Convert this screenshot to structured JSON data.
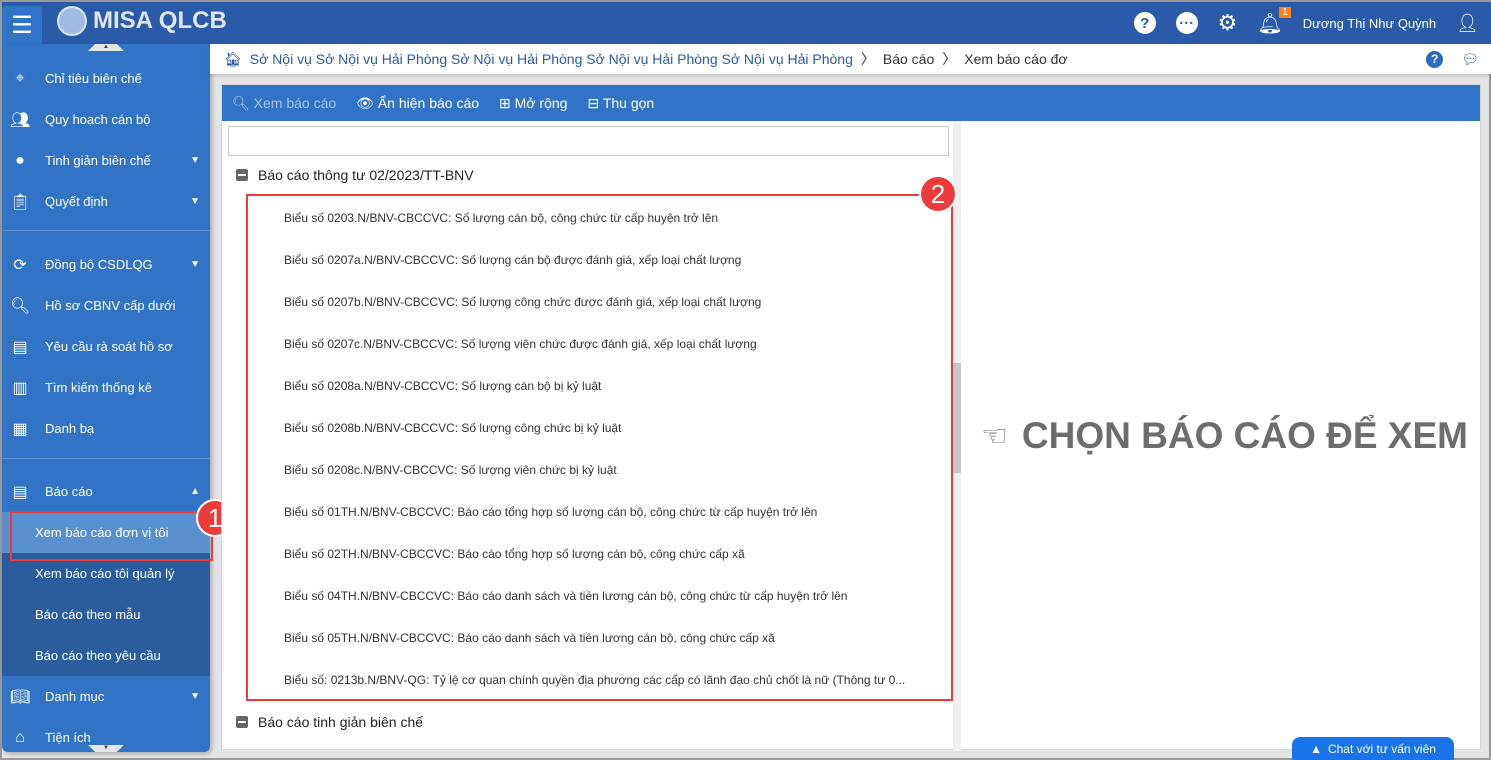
{
  "app": {
    "title": "MISA QLCB"
  },
  "header": {
    "notif_count": "1",
    "user_name": "Dương Thị Như Quỳnh"
  },
  "sidebar": {
    "items": [
      {
        "label": "Chỉ tiêu biên chế",
        "icon": "target-user-icon"
      },
      {
        "label": "Quy hoạch cán bộ",
        "icon": "people-icon"
      },
      {
        "label": "Tinh giản biên chế",
        "icon": "dots-icon",
        "caret": true
      },
      {
        "label": "Quyết định",
        "icon": "clipboard-icon",
        "caret": true
      },
      {
        "label": "Đồng bộ CSDLQG",
        "icon": "sync-icon",
        "caret": true
      },
      {
        "label": "Hồ sơ CBNV cấp dưới",
        "icon": "search-icon"
      },
      {
        "label": "Yêu cầu rà soát hồ sơ",
        "icon": "form-icon"
      },
      {
        "label": "Tìm kiếm thống kê",
        "icon": "chart-icon"
      },
      {
        "label": "Danh bạ",
        "icon": "contacts-icon"
      },
      {
        "label": "Báo cáo",
        "icon": "document-icon",
        "caret": true
      },
      {
        "label": "Danh mục",
        "icon": "book-icon",
        "caret": true
      },
      {
        "label": "Tiện ích",
        "icon": "home-icon"
      }
    ],
    "report_sub": [
      "Xem báo cáo đơn vị tôi",
      "Xem báo cáo tôi quản lý",
      "Báo cáo theo mẫu",
      "Báo cáo theo yêu cầu"
    ]
  },
  "breadcrumb": [
    "Sở Nội vụ Sở Nội vụ Hải Phòng Sở Nội vụ Hải Phòng Sở Nội vụ Hải Phòng Sở Nội vụ Hải Phòng",
    "Báo cáo",
    "Xem báo cáo đơ"
  ],
  "toolbar": {
    "view": "Xem báo cáo",
    "toggle": "Ẩn hiện báo cáo",
    "expand": "Mở rộng",
    "collapse": "Thu gọn"
  },
  "search": {
    "value": ""
  },
  "groups": [
    "Báo cáo thông tư 02/2023/TT-BNV",
    "Báo cáo tinh giản biên chế"
  ],
  "reports": [
    "Biểu số 0203.N/BNV-CBCCVC: Số lượng cán bộ, công chức từ cấp huyện trở lên",
    "Biểu số 0207a.N/BNV-CBCCVC: Số lượng cán bộ được đánh giá, xếp loại chất lượng",
    "Biểu số 0207b.N/BNV-CBCCVC: Số lượng công chức được đánh giá, xếp loại chất lượng",
    "Biểu số 0207c.N/BNV-CBCCVC: Số lượng viên chức được đánh giá, xếp loại chất lượng",
    "Biểu số 0208a.N/BNV-CBCCVC: Số lượng cán bộ bị kỷ luật",
    "Biểu số 0208b.N/BNV-CBCCVC: Số lượng công chức bị kỷ luật",
    "Biểu số 0208c.N/BNV-CBCCVC: Số lượng viên chức bị kỷ luật",
    "Biểu số 01TH.N/BNV-CBCCVC: Báo cáo tổng hợp số lượng cán bộ, công chức từ cấp huyện trở lên",
    "Biểu số 02TH.N/BNV-CBCCVC: Báo cáo tổng hợp số lượng cán bộ, công chức cấp xã",
    "Biểu số 04TH.N/BNV-CBCCVC: Báo cáo danh sách và tiền lương cán bộ, công chức từ cấp huyện trở lên",
    "Biểu số 05TH.N/BNV-CBCCVC: Báo cáo danh sách và tiền lương cán bộ, công chức cấp xã",
    "Biểu số: 0213b.N/BNV-QG: Tỷ lệ cơ quan chính quyền địa phương các cấp có lãnh đạo chủ chốt là nữ (Thông tư 0..."
  ],
  "placeholder": {
    "text": "CHỌN BÁO CÁO ĐỂ XEM"
  },
  "annotations": [
    "1",
    "2"
  ],
  "chat": {
    "label": "Chat với tư vấn viên"
  }
}
